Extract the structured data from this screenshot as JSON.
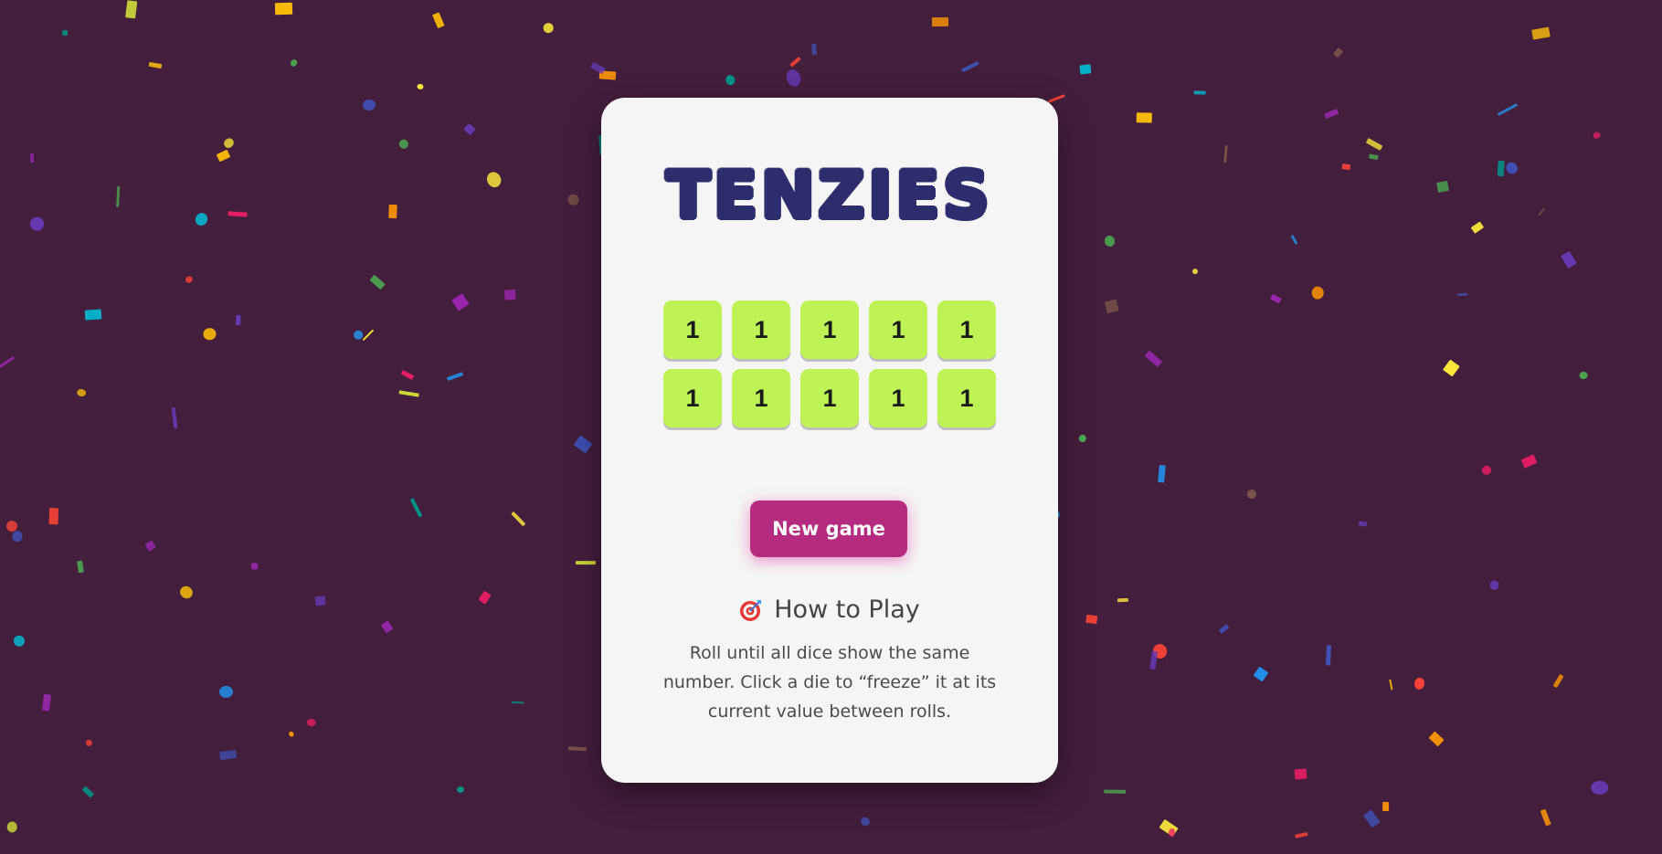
{
  "app": {
    "title": "TENZIES"
  },
  "dice": [
    {
      "value": "1"
    },
    {
      "value": "1"
    },
    {
      "value": "1"
    },
    {
      "value": "1"
    },
    {
      "value": "1"
    },
    {
      "value": "1"
    },
    {
      "value": "1"
    },
    {
      "value": "1"
    },
    {
      "value": "1"
    },
    {
      "value": "1"
    }
  ],
  "controls": {
    "new_game_label": "New game"
  },
  "instructions": {
    "heading": "How to Play",
    "icon": "target-icon",
    "text": "Roll until all dice show the same number. Click a die to “freeze” it at its current value between rolls."
  },
  "colors": {
    "background": "#441e3d",
    "card": "#f5f5f5",
    "title": "#2d2d6e",
    "die": "#bdf354",
    "button": "#b52b7f"
  }
}
